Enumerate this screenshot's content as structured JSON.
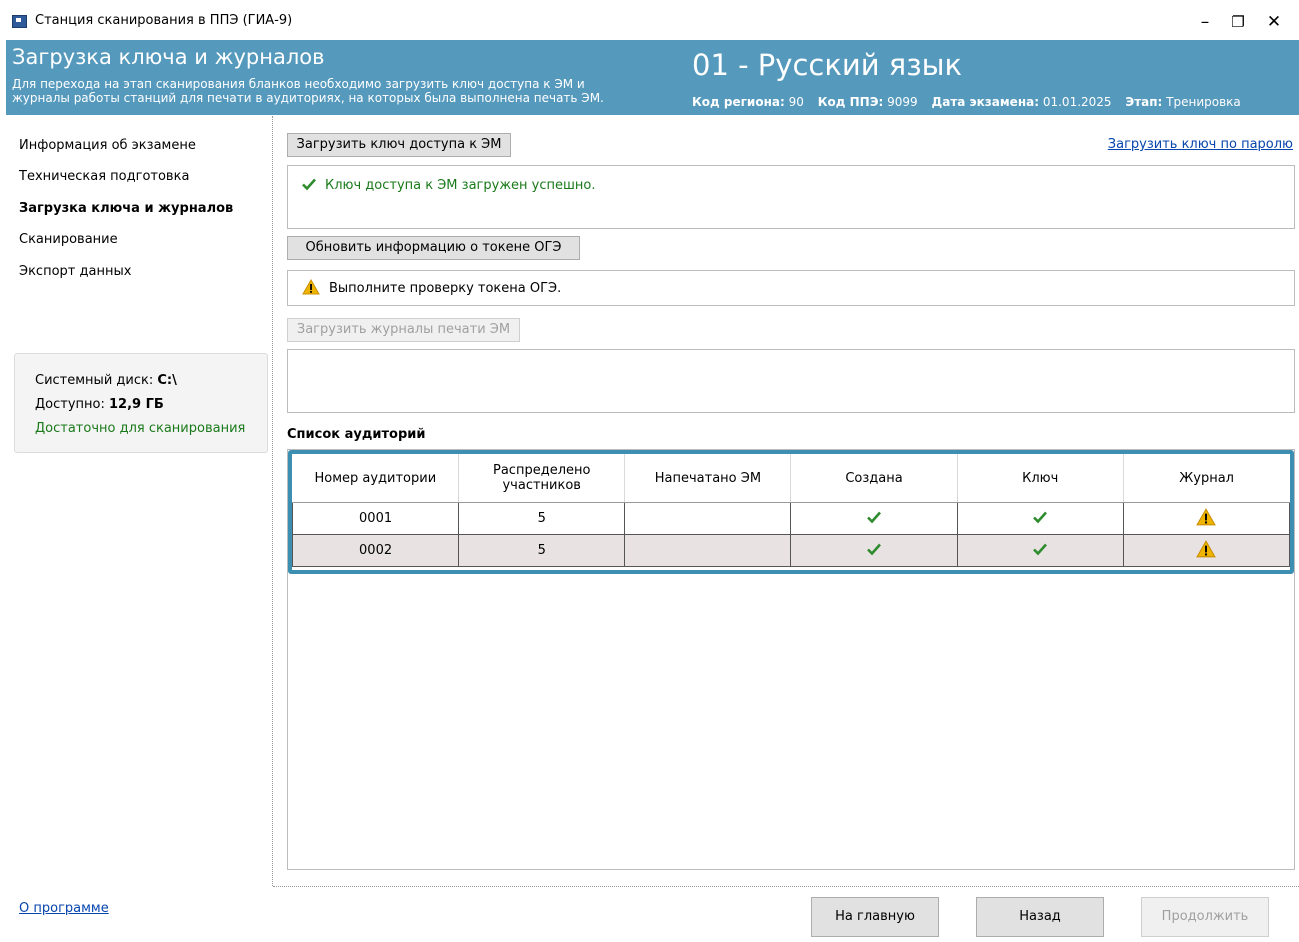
{
  "window": {
    "title": "Станция сканирования в ППЭ (ГИА-9)",
    "minimize": "–",
    "restore": "❐",
    "close": "✕"
  },
  "header": {
    "title": "Загрузка ключа и журналов",
    "desc_line1": "Для перехода на этап сканирования бланков необходимо загрузить ключ доступа к ЭМ и",
    "desc_line2": "журналы работы станций для печати в аудиториях, на которых была выполнена печать ЭМ.",
    "subject": "01 - Русский язык",
    "region_label": "Код региона:",
    "region_value": "90",
    "ppe_label": "Код ППЭ:",
    "ppe_value": "9099",
    "date_label": "Дата экзамена:",
    "date_value": "01.01.2025",
    "stage_label": "Этап:",
    "stage_value": "Тренировка"
  },
  "sidebar": {
    "items": [
      {
        "label": "Информация об экзамене"
      },
      {
        "label": "Техническая подготовка"
      },
      {
        "label": "Загрузка ключа и журналов"
      },
      {
        "label": "Сканирование"
      },
      {
        "label": "Экспорт данных"
      }
    ],
    "disk": {
      "label": "Системный диск:",
      "value": "C:\\",
      "avail_label": "Доступно:",
      "avail_value": "12,9 ГБ",
      "status": "Достаточно для сканирования",
      "status_color": "#1a7a1a"
    },
    "about": "О программе"
  },
  "main": {
    "load_key_button": "Загрузить ключ доступа к ЭМ",
    "load_by_password_link": "Загрузить ключ по паролю",
    "key_status": "Ключ доступа к ЭМ загружен успешно.",
    "update_token_button": "Обновить информацию о токене ОГЭ",
    "token_status": "Выполните проверку токена ОГЭ.",
    "load_journals_button": "Загрузить журналы печати ЭМ",
    "list_title": "Список аудиторий",
    "table": {
      "headers": [
        "Номер аудитории",
        "Распределено участников",
        "Напечатано ЭМ",
        "Создана",
        "Ключ",
        "Журнал"
      ],
      "rows": [
        {
          "room": "0001",
          "assigned": "5",
          "printed": "",
          "created": "check-icon",
          "key": "check-icon",
          "journal": "warning-icon"
        },
        {
          "room": "0002",
          "assigned": "5",
          "printed": "",
          "created": "check-icon",
          "key": "check-icon",
          "journal": "warning-icon"
        }
      ]
    }
  },
  "footer": {
    "home": "На главную",
    "back": "Назад",
    "continue": "Продолжить"
  },
  "colors": {
    "header_bg": "#5599bd",
    "table_frame": "#3d8fb2",
    "ok_green": "#1a7a1a",
    "warning": "#f0b400"
  }
}
